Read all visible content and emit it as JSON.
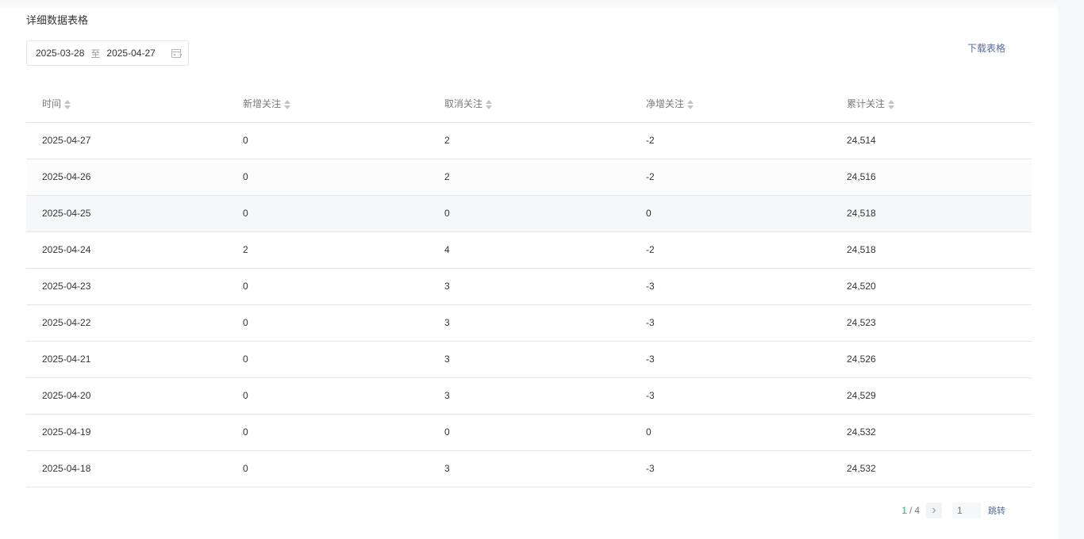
{
  "section_title": "详细数据表格",
  "date_range": {
    "start": "2025-03-28",
    "separator": "至",
    "end": "2025-04-27"
  },
  "download_label": "下载表格",
  "table": {
    "headers": [
      "时间",
      "新增关注",
      "取消关注",
      "净增关注",
      "累计关注"
    ],
    "rows": [
      [
        "2025-04-27",
        "0",
        "2",
        "-2",
        "24,514"
      ],
      [
        "2025-04-26",
        "0",
        "2",
        "-2",
        "24,516"
      ],
      [
        "2025-04-25",
        "0",
        "0",
        "0",
        "24,518"
      ],
      [
        "2025-04-24",
        "2",
        "4",
        "-2",
        "24,518"
      ],
      [
        "2025-04-23",
        "0",
        "3",
        "-3",
        "24,520"
      ],
      [
        "2025-04-22",
        "0",
        "3",
        "-3",
        "24,523"
      ],
      [
        "2025-04-21",
        "0",
        "3",
        "-3",
        "24,526"
      ],
      [
        "2025-04-20",
        "0",
        "3",
        "-3",
        "24,529"
      ],
      [
        "2025-04-19",
        "0",
        "0",
        "0",
        "24,532"
      ],
      [
        "2025-04-18",
        "0",
        "3",
        "-3",
        "24,532"
      ]
    ]
  },
  "pagination": {
    "current": "1",
    "separator": "/",
    "total": "4",
    "next_icon": "chevron-right-icon",
    "input_placeholder": "1",
    "jump_label": "跳转"
  },
  "colors": {
    "accent_green": "#07c160",
    "link_blue": "#576b95"
  }
}
